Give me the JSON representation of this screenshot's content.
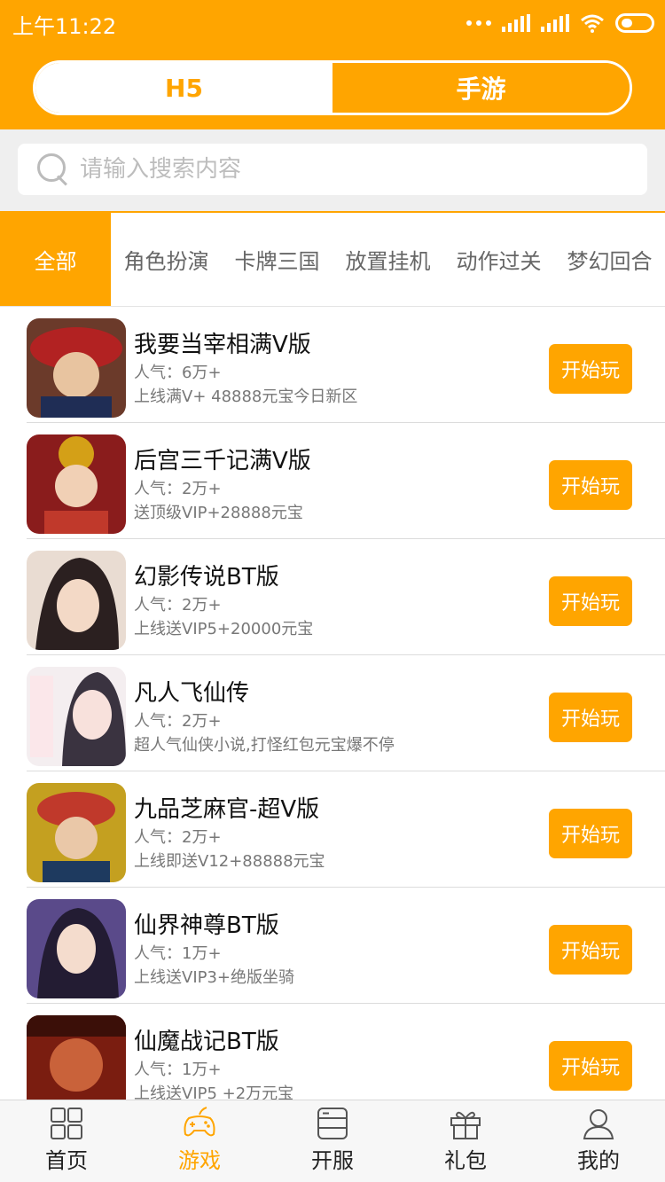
{
  "status": {
    "time": "上午11:22"
  },
  "header": {
    "tabs": [
      {
        "label": "H5"
      },
      {
        "label": "手游"
      }
    ]
  },
  "search": {
    "placeholder": "请输入搜索内容"
  },
  "categories": [
    "全部",
    "角色扮演",
    "卡牌三国",
    "放置挂机",
    "动作过关",
    "梦幻回合"
  ],
  "games": [
    {
      "title": "我要当宰相满V版",
      "popularity": "人气：6万+",
      "desc": "上线满V+ 48888元宝今日新区",
      "button": "开始玩"
    },
    {
      "title": "后宫三千记满V版",
      "popularity": "人气：2万+",
      "desc": "送顶级VIP+28888元宝",
      "button": "开始玩"
    },
    {
      "title": "幻影传说BT版",
      "popularity": "人气：2万+",
      "desc": "上线送VIP5+20000元宝",
      "button": "开始玩"
    },
    {
      "title": "凡人飞仙传",
      "popularity": "人气：2万+",
      "desc": "超人气仙侠小说,打怪红包元宝爆不停",
      "button": "开始玩"
    },
    {
      "title": "九品芝麻官-超V版",
      "popularity": "人气：2万+",
      "desc": "上线即送V12+88888元宝",
      "button": "开始玩"
    },
    {
      "title": "仙界神尊BT版",
      "popularity": "人气：1万+",
      "desc": "上线送VIP3+绝版坐骑",
      "button": "开始玩"
    },
    {
      "title": "仙魔战记BT版",
      "popularity": "人气：1万+",
      "desc": "上线送VIP5 +2万元宝",
      "button": "开始玩"
    }
  ],
  "bottom_nav": [
    {
      "label": "首页",
      "icon": "grid-icon"
    },
    {
      "label": "游戏",
      "icon": "gamepad-icon",
      "active": true
    },
    {
      "label": "开服",
      "icon": "server-icon"
    },
    {
      "label": "礼包",
      "icon": "gift-icon"
    },
    {
      "label": "我的",
      "icon": "user-icon"
    }
  ],
  "colors": {
    "accent": "#FFA500"
  }
}
